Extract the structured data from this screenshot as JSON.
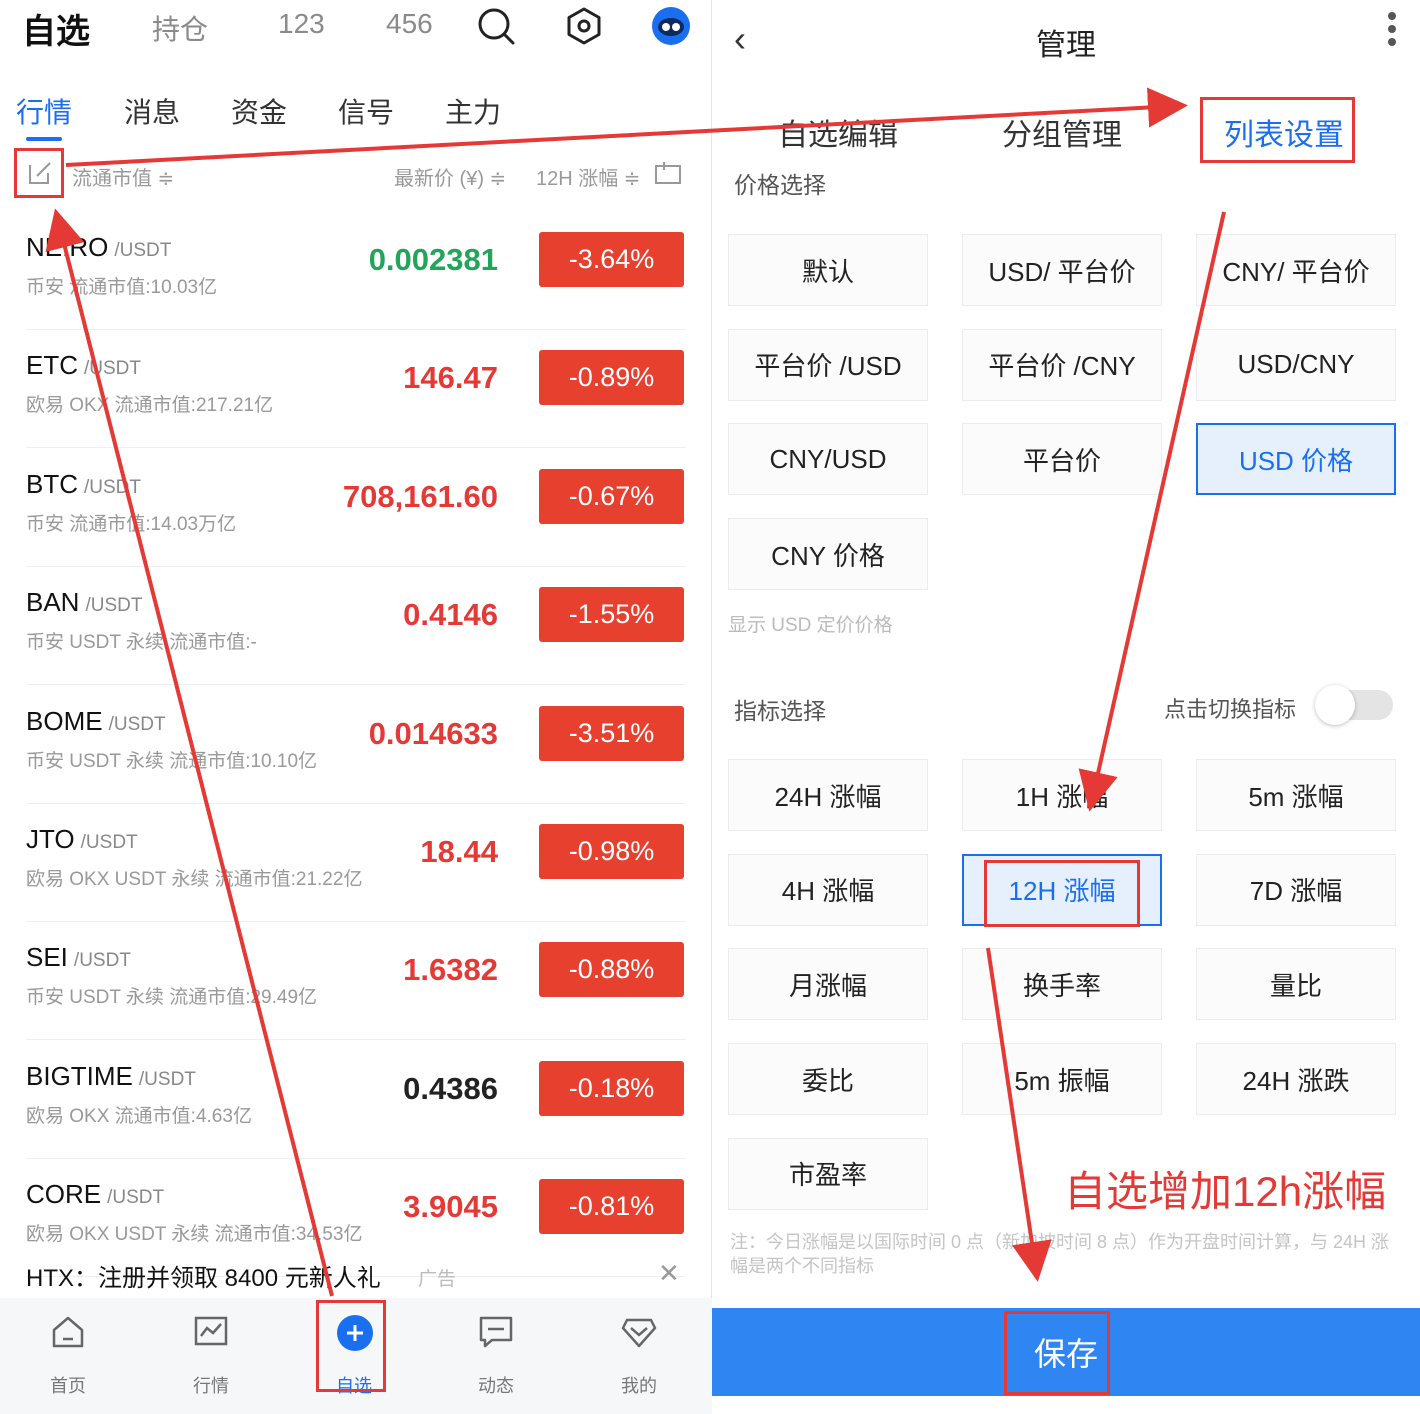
{
  "left": {
    "top_tabs": [
      "自选",
      "持仓",
      "123",
      "456"
    ],
    "sub_tabs": [
      "行情",
      "消息",
      "资金",
      "信号",
      "主力"
    ],
    "columns": {
      "market_cap": "流通市值 ≑",
      "price": "最新价 (¥) ≑",
      "change": "12H 涨幅 ≑"
    },
    "rows": [
      {
        "symbol": "NEIRO",
        "quote": "/USDT",
        "sub": "币安 流通市值:10.03亿",
        "price": "0.002381",
        "change": "-3.64%",
        "price_color": "#22a559"
      },
      {
        "symbol": "ETC",
        "quote": "/USDT",
        "sub": "欧易 OKX 流通市值:217.21亿",
        "price": "146.47",
        "change": "-0.89%",
        "price_color": "#e53935"
      },
      {
        "symbol": "BTC",
        "quote": "/USDT",
        "sub": "币安 流通市值:14.03万亿",
        "price": "708,161.60",
        "change": "-0.67%",
        "price_color": "#e53935"
      },
      {
        "symbol": "BAN",
        "quote": "/USDT",
        "sub": "币安 USDT 永续 流通市值:-",
        "price": "0.4146",
        "change": "-1.55%",
        "price_color": "#e53935"
      },
      {
        "symbol": "BOME",
        "quote": "/USDT",
        "sub": "币安 USDT 永续 流通市值:10.10亿",
        "price": "0.014633",
        "change": "-3.51%",
        "price_color": "#e53935"
      },
      {
        "symbol": "JTO",
        "quote": "/USDT",
        "sub": "欧易 OKX USDT 永续 流通市值:21.22亿",
        "price": "18.44",
        "change": "-0.98%",
        "price_color": "#e53935"
      },
      {
        "symbol": "SEI",
        "quote": "/USDT",
        "sub": "币安 USDT 永续 流通市值:29.49亿",
        "price": "1.6382",
        "change": "-0.88%",
        "price_color": "#e53935"
      },
      {
        "symbol": "BIGTIME",
        "quote": "/USDT",
        "sub": "欧易 OKX 流通市值:4.63亿",
        "price": "0.4386",
        "change": "-0.18%",
        "price_color": "#222222"
      },
      {
        "symbol": "CORE",
        "quote": "/USDT",
        "sub": "欧易 OKX USDT 永续 流通市值:34.53亿",
        "price": "3.9045",
        "change": "-0.81%",
        "price_color": "#e53935"
      }
    ],
    "ad": {
      "text": "HTX：注册并领取 8400 元新人礼",
      "tag": "广告",
      "close": "✕"
    },
    "nav": [
      "首页",
      "行情",
      "自选",
      "动态",
      "我的"
    ]
  },
  "right": {
    "back": "‹",
    "title": "管理",
    "tabs": [
      "自选编辑",
      "分组管理",
      "列表设置"
    ],
    "price_section": "价格选择",
    "price_options": [
      "默认",
      "USD/ 平台价",
      "CNY/ 平台价",
      "平台价 /USD",
      "平台价 /CNY",
      "USD/CNY",
      "CNY/USD",
      "平台价",
      "USD 价格",
      "CNY 价格"
    ],
    "price_hint": "显示 USD 定价价格",
    "indicator_section": "指标选择",
    "toggle_label": "点击切换指标",
    "indicator_options": [
      "24H 涨幅",
      "1H 涨幅",
      "5m 涨幅",
      "4H 涨幅",
      "12H 涨幅",
      "7D 涨幅",
      "月涨幅",
      "换手率",
      "量比",
      "委比",
      "5m 振幅",
      "24H 涨跌",
      "市盈率"
    ],
    "annotation": "自选增加12h涨幅",
    "footnote": "注：今日涨幅是以国际时间 0 点（新加坡时间 8 点）作为开盘时间计算，与 24H 涨幅是两个不同指标",
    "save": "保存"
  },
  "colors": {
    "accent": "#1a6ef0",
    "down": "#e8402f",
    "up": "#22a559",
    "annotation": "#e53935"
  }
}
